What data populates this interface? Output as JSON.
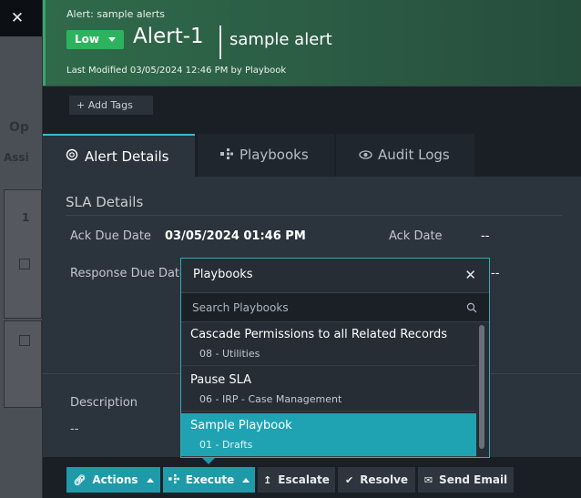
{
  "alert": {
    "breadcrumb": "Alert: sample alerts",
    "severity": "Low",
    "id": "Alert-1",
    "name": "sample alert",
    "last_modified": "Last Modified 03/05/2024 12:46 PM by Playbook",
    "severity_color": "#2db35d"
  },
  "tags": {
    "add_label": "+ Add Tags"
  },
  "tabs": [
    {
      "label": "Alert Details",
      "icon": "info-icon"
    },
    {
      "label": "Playbooks",
      "icon": "playbook-icon"
    },
    {
      "label": "Audit Logs",
      "icon": "eye-icon"
    }
  ],
  "sla": {
    "title": "SLA Details",
    "ack_due_label": "Ack Due Date",
    "ack_due_value": "03/05/2024 01:46 PM",
    "ack_date_label": "Ack Date",
    "ack_date_value": "--",
    "response_due_label": "Response Due Date",
    "response_due_value": "--"
  },
  "description": {
    "label": "Description",
    "value": "--"
  },
  "playbooks_popup": {
    "title": "Playbooks",
    "search_placeholder": "Search Playbooks",
    "items": [
      {
        "name": "Cascade Permissions to all Related Records",
        "category": "08 - Utilities"
      },
      {
        "name": "Pause SLA",
        "category": "06 - IRP - Case Management"
      },
      {
        "name": "Sample Playbook",
        "category": "01 - Drafts"
      }
    ]
  },
  "actions": {
    "actions_label": "Actions",
    "execute_label": "Execute",
    "escalate_label": "Escalate",
    "resolve_label": "Resolve",
    "send_email_label": "Send Email"
  },
  "background": {
    "ghost_1": "Op",
    "ghost_2": "Assi",
    "ghost_3": "1"
  },
  "colors": {
    "accent": "#1e9aa9",
    "header": "#2f6a4a",
    "selected": "#1fa3b3"
  }
}
